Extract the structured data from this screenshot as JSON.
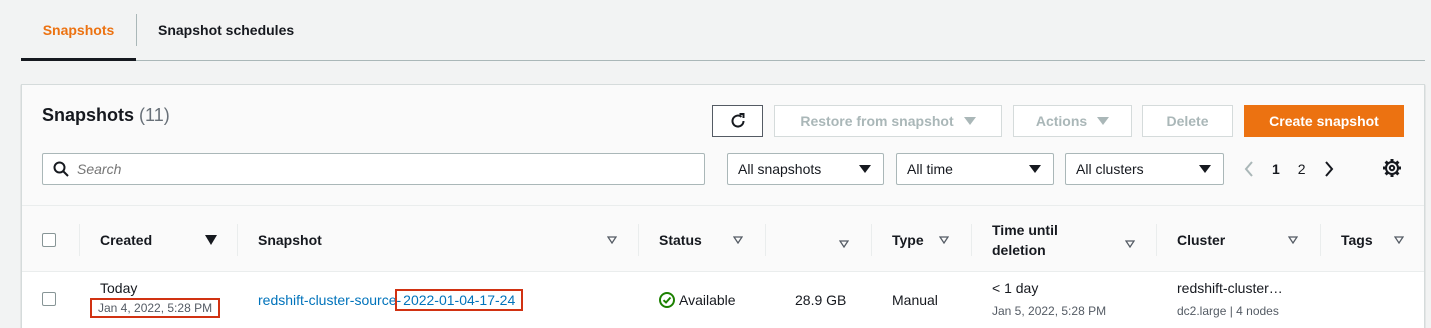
{
  "tabs": [
    {
      "label": "Snapshots",
      "active": true
    },
    {
      "label": "Snapshot schedules",
      "active": false
    }
  ],
  "panel": {
    "title": "Snapshots",
    "count": "(11)"
  },
  "toolbar": {
    "restore_label": "Restore from snapshot",
    "actions_label": "Actions",
    "delete_label": "Delete",
    "create_label": "Create snapshot"
  },
  "filters": {
    "search_placeholder": "Search",
    "snapshot_filter": "All snapshots",
    "time_filter": "All time",
    "cluster_filter": "All clusters"
  },
  "pagination": {
    "current": "1",
    "next_page": "2"
  },
  "columns": {
    "created": "Created",
    "snapshot": "Snapshot",
    "status": "Status",
    "type": "Type",
    "time_until_line1": "Time until",
    "time_until_line2": "deletion",
    "cluster": "Cluster",
    "tags": "Tags"
  },
  "rows": [
    {
      "created_day": "Today",
      "created_date": "Jan 4, 2022, 5:28 PM",
      "snapshot_prefix": "redshift-cluster-source-",
      "snapshot_suffix": "2022-01-04-17-24",
      "status": "Available",
      "size": "28.9 GB",
      "type": "Manual",
      "deletion": "< 1 day",
      "deletion_date": "Jan 5, 2022, 5:28 PM",
      "cluster": "redshift-cluster…",
      "cluster_detail": "dc2.large | 4 nodes"
    }
  ],
  "colors": {
    "accent": "#ec7211",
    "link": "#0073bb",
    "success": "#1d8102",
    "highlight": "#d13212"
  }
}
